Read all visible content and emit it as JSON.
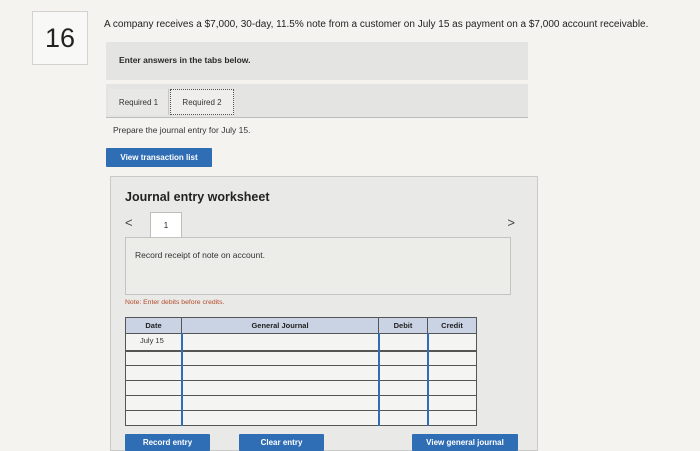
{
  "question": {
    "number": "16",
    "prompt": "A company receives a $7,000, 30-day, 11.5% note from a customer on July 15 as payment on a $7,000 account receivable.",
    "instruction": "Enter answers in the tabs below."
  },
  "tabs": [
    {
      "label": "Required 1"
    },
    {
      "label": "Required 2"
    }
  ],
  "prepare_text": "Prepare the journal entry for July 15.",
  "view_transaction_list_label": "View transaction list",
  "worksheet": {
    "title": "Journal entry worksheet",
    "nav_prev": "<",
    "nav_next": ">",
    "page": "1",
    "record_text": "Record receipt of note on account.",
    "note": "Note: Enter debits before credits.",
    "columns": {
      "date": "Date",
      "journal": "General Journal",
      "debit": "Debit",
      "credit": "Credit"
    },
    "rows": [
      {
        "date": "July 15",
        "journal": "",
        "debit": "",
        "credit": ""
      },
      {
        "date": "",
        "journal": "",
        "debit": "",
        "credit": ""
      },
      {
        "date": "",
        "journal": "",
        "debit": "",
        "credit": ""
      },
      {
        "date": "",
        "journal": "",
        "debit": "",
        "credit": ""
      },
      {
        "date": "",
        "journal": "",
        "debit": "",
        "credit": ""
      },
      {
        "date": "",
        "journal": "",
        "debit": "",
        "credit": ""
      }
    ]
  },
  "buttons": {
    "record_entry": "Record entry",
    "clear_entry": "Clear entry",
    "view_general_journal": "View general journal"
  },
  "colors": {
    "accent": "#2f6db5",
    "header_fill": "#c9d3e3",
    "note_text": "#b34a2a"
  }
}
